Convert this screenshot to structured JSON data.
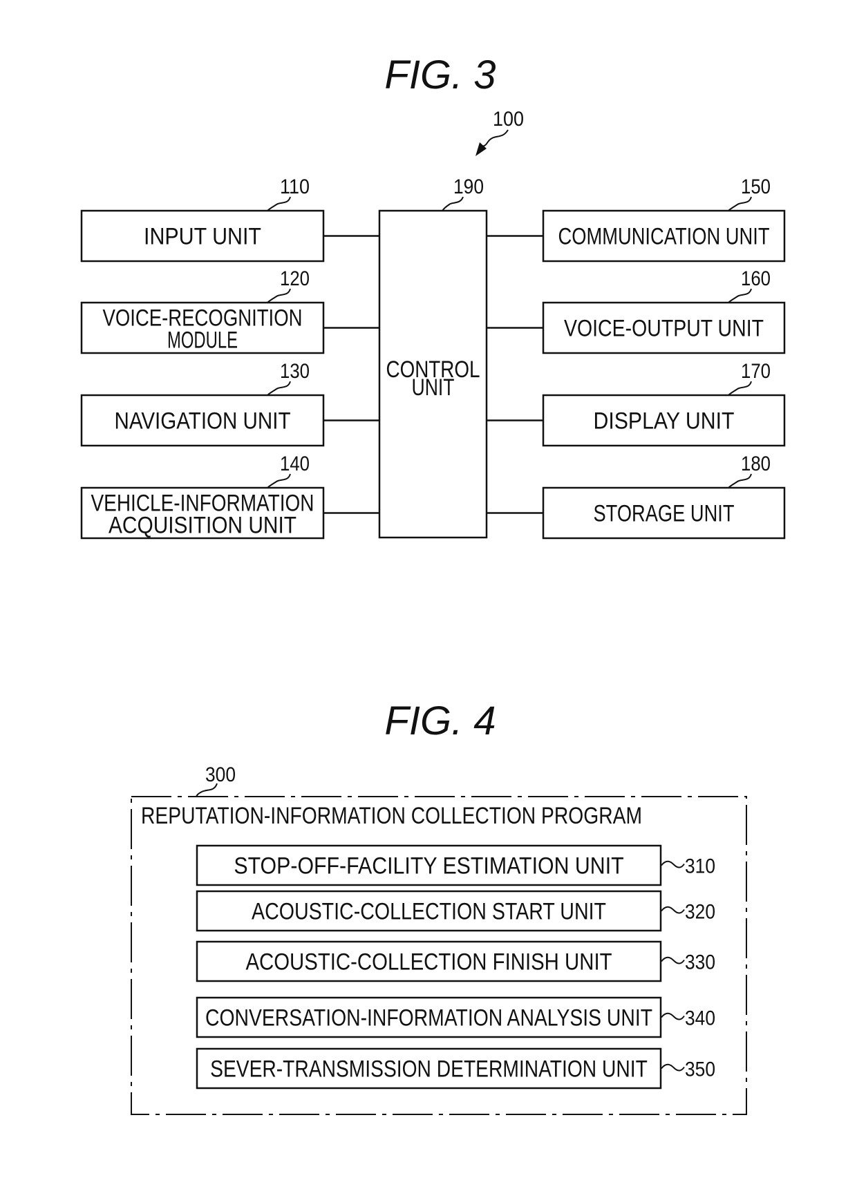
{
  "fig3": {
    "title": "FIG. 3",
    "system_ref": "100",
    "control": {
      "ref": "190",
      "label_lines": [
        "CONTROL",
        "UNIT"
      ]
    },
    "left_units": [
      {
        "ref": "110",
        "label_lines": [
          "INPUT UNIT"
        ]
      },
      {
        "ref": "120",
        "label_lines": [
          "VOICE-RECOGNITION",
          "MODULE"
        ]
      },
      {
        "ref": "130",
        "label_lines": [
          "NAVIGATION UNIT"
        ]
      },
      {
        "ref": "140",
        "label_lines": [
          "VEHICLE-INFORMATION",
          "ACQUISITION UNIT"
        ]
      }
    ],
    "right_units": [
      {
        "ref": "150",
        "label_lines": [
          "COMMUNICATION UNIT"
        ]
      },
      {
        "ref": "160",
        "label_lines": [
          "VOICE-OUTPUT UNIT"
        ]
      },
      {
        "ref": "170",
        "label_lines": [
          "DISPLAY UNIT"
        ]
      },
      {
        "ref": "180",
        "label_lines": [
          "STORAGE UNIT"
        ]
      }
    ]
  },
  "fig4": {
    "title": "FIG. 4",
    "program_ref": "300",
    "program_label": "REPUTATION-INFORMATION COLLECTION PROGRAM",
    "modules": [
      {
        "ref": "310",
        "label": "STOP-OFF-FACILITY ESTIMATION UNIT"
      },
      {
        "ref": "320",
        "label": "ACOUSTIC-COLLECTION START UNIT"
      },
      {
        "ref": "330",
        "label": "ACOUSTIC-COLLECTION FINISH UNIT"
      },
      {
        "ref": "340",
        "label": "CONVERSATION-INFORMATION ANALYSIS UNIT"
      },
      {
        "ref": "350",
        "label": "SEVER-TRANSMISSION DETERMINATION UNIT"
      }
    ]
  }
}
